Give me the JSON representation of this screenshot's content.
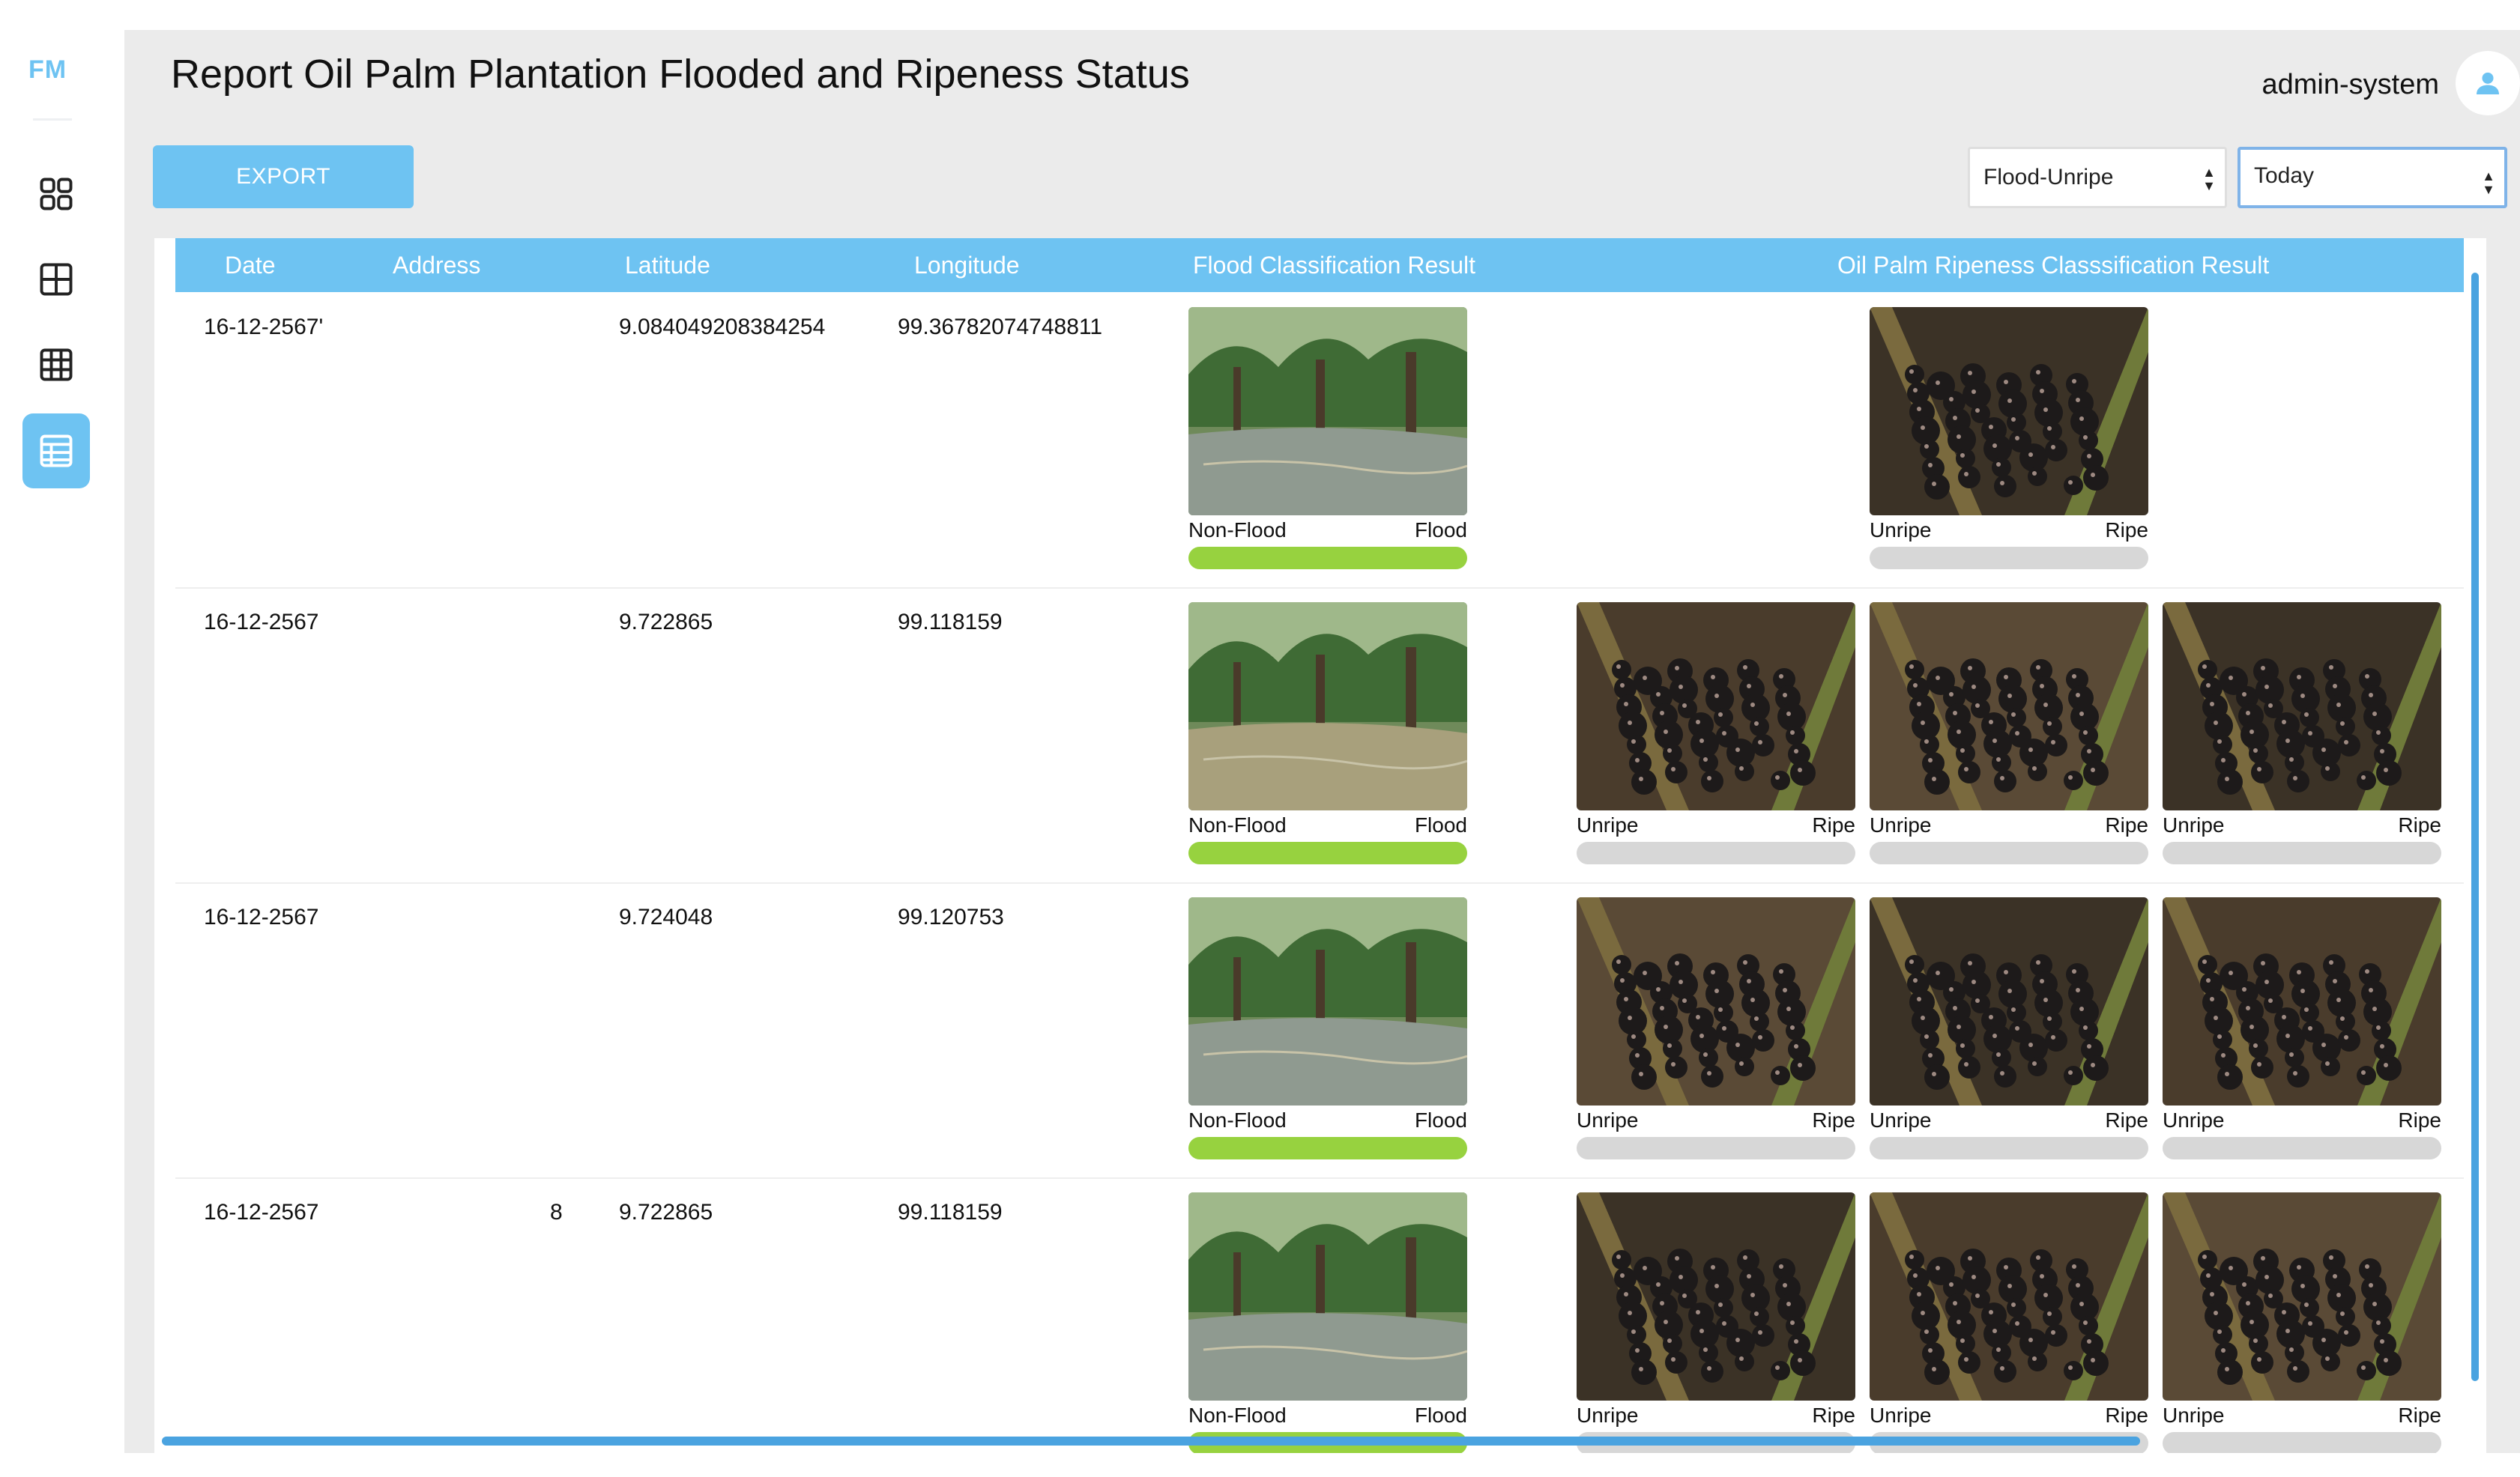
{
  "app": {
    "logo": "FM"
  },
  "sidebar": {
    "items": [
      {
        "icon": "dashboard-icon"
      },
      {
        "icon": "grid-icon"
      },
      {
        "icon": "table-icon"
      },
      {
        "icon": "report-table-icon",
        "active": true
      }
    ]
  },
  "header": {
    "title": "Report Oil Palm Plantation Flooded and Ripeness Status",
    "user": "admin-system"
  },
  "toolbar": {
    "export_label": "EXPORT",
    "filter_value": "Flood-Unripe",
    "date_value": "Today"
  },
  "table": {
    "columns": [
      "Date",
      "Address",
      "Latitude",
      "Longitude",
      "Flood Classification Result",
      "Oil Palm Ripeness Classsification Result"
    ],
    "flood_labels": {
      "left": "Non-Flood",
      "right": "Flood"
    },
    "ripe_labels": {
      "left": "Unripe",
      "right": "Ripe"
    },
    "rows": [
      {
        "date": "16-12-2567'",
        "address": "",
        "latitude": "9.084049208384254",
        "longitude": "99.36782074748811",
        "flood_images": 1,
        "ripeness_images": 1
      },
      {
        "date": "16-12-2567",
        "address": "",
        "latitude": "9.722865",
        "longitude": "99.118159",
        "flood_images": 1,
        "ripeness_images": 3
      },
      {
        "date": "16-12-2567",
        "address": "",
        "latitude": "9.724048",
        "longitude": "99.120753",
        "flood_images": 1,
        "ripeness_images": 3
      },
      {
        "date": "16-12-2567",
        "address": "8",
        "latitude": "9.722865",
        "longitude": "99.118159",
        "flood_images": 1,
        "ripeness_images": 3
      }
    ]
  },
  "colors": {
    "accent": "#6ec3f2",
    "flood_bar": "#97d23f",
    "empty_bar": "#d7d7d7",
    "scrollbar": "#4aa3e0",
    "panel_bg": "#ebebeb"
  }
}
